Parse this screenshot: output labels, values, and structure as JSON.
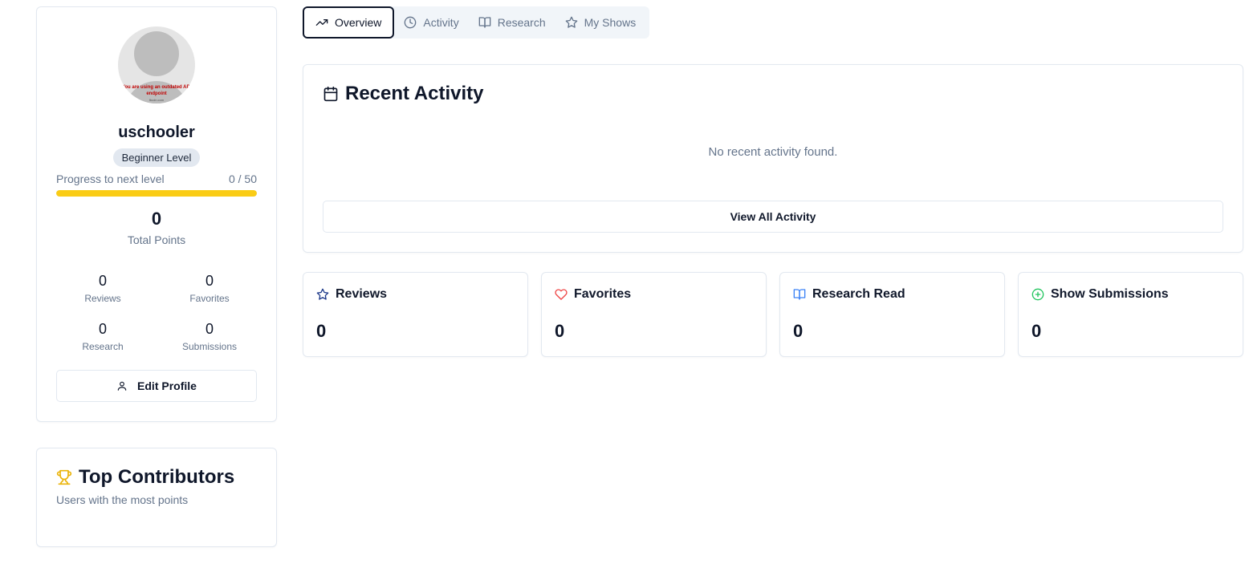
{
  "profile": {
    "avatar_warning": "You are using an outdated API endpoint",
    "avatar_warning_sub": "fbcdn.com",
    "username": "uschooler",
    "level": "Beginner Level",
    "progress_label": "Progress to next level",
    "progress_value": "0 / 50",
    "progress_fraction": 1.0,
    "total_points": "0",
    "total_points_label": "Total Points",
    "stats": [
      {
        "value": "0",
        "label": "Reviews"
      },
      {
        "value": "0",
        "label": "Favorites"
      },
      {
        "value": "0",
        "label": "Research"
      },
      {
        "value": "0",
        "label": "Submissions"
      }
    ],
    "edit_button": "Edit Profile"
  },
  "contributors": {
    "title": "Top Contributors",
    "subtitle": "Users with the most points"
  },
  "tabs": [
    {
      "label": "Overview",
      "icon": "trending-up-icon",
      "active": true
    },
    {
      "label": "Activity",
      "icon": "clock-icon",
      "active": false
    },
    {
      "label": "Research",
      "icon": "book-open-icon",
      "active": false
    },
    {
      "label": "My Shows",
      "icon": "star-icon",
      "active": false
    }
  ],
  "recent_activity": {
    "title": "Recent Activity",
    "empty_message": "No recent activity found.",
    "view_all_button": "View All Activity"
  },
  "stat_cards": [
    {
      "label": "Reviews",
      "value": "0",
      "icon": "star-icon",
      "color": "#1e3a8a"
    },
    {
      "label": "Favorites",
      "value": "0",
      "icon": "heart-icon",
      "color": "#ef4444"
    },
    {
      "label": "Research Read",
      "value": "0",
      "icon": "book-open-icon",
      "color": "#3b82f6"
    },
    {
      "label": "Show Submissions",
      "value": "0",
      "icon": "plus-circle-icon",
      "color": "#22c55e"
    }
  ],
  "colors": {
    "accent": "#facc15",
    "trophy": "#eab308",
    "border": "#e2e8f0",
    "muted": "#64748b"
  }
}
